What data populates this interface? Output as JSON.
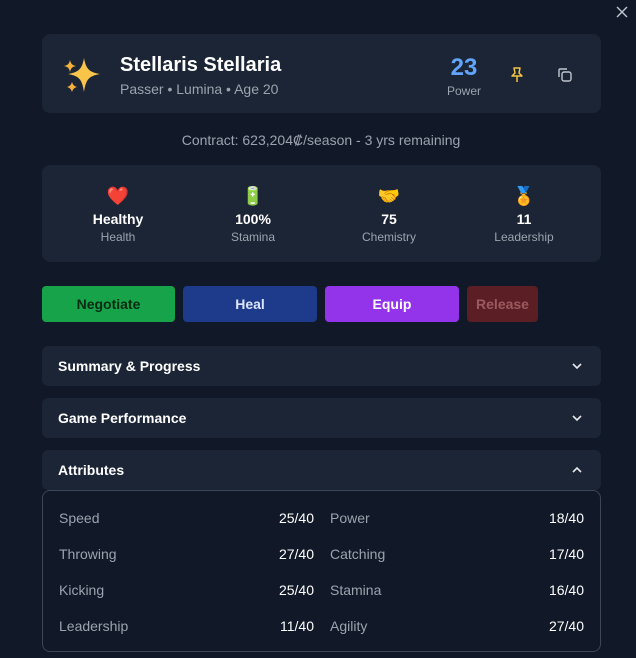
{
  "close_icon": "close-icon",
  "player": {
    "avatar_icon": "sparkles-icon",
    "name": "Stellaris Stellaria",
    "subtitle": "Passer • Lumina • Age 20",
    "power_value": "23",
    "power_label": "Power"
  },
  "contract_text": "Contract: 623,204₡/season - 3 yrs remaining",
  "stats": [
    {
      "icon": "heart-icon",
      "emoji": "❤️",
      "value": "Healthy",
      "label": "Health"
    },
    {
      "icon": "battery-icon",
      "emoji": "🔋",
      "value": "100%",
      "label": "Stamina"
    },
    {
      "icon": "handshake-icon",
      "emoji": "🤝",
      "value": "75",
      "label": "Chemistry"
    },
    {
      "icon": "medal-icon",
      "emoji": "🏅",
      "value": "11",
      "label": "Leadership"
    }
  ],
  "actions": {
    "negotiate": "Negotiate",
    "heal": "Heal",
    "equip": "Equip",
    "release": "Release"
  },
  "sections": {
    "summary": "Summary & Progress",
    "performance": "Game Performance",
    "attributes": "Attributes"
  },
  "attributes": [
    {
      "name": "Speed",
      "value": "25/40"
    },
    {
      "name": "Power",
      "value": "18/40"
    },
    {
      "name": "Throwing",
      "value": "27/40"
    },
    {
      "name": "Catching",
      "value": "17/40"
    },
    {
      "name": "Kicking",
      "value": "25/40"
    },
    {
      "name": "Stamina",
      "value": "16/40"
    },
    {
      "name": "Leadership",
      "value": "11/40"
    },
    {
      "name": "Agility",
      "value": "27/40"
    }
  ],
  "colors": {
    "background": "#111827",
    "card": "#1c2535",
    "power_accent": "#60a5fa",
    "pin_accent": "#f5c542",
    "negotiate": "#16a34a",
    "heal": "#1e3a8a",
    "equip": "#9333ea",
    "release": "#5b1e24"
  }
}
